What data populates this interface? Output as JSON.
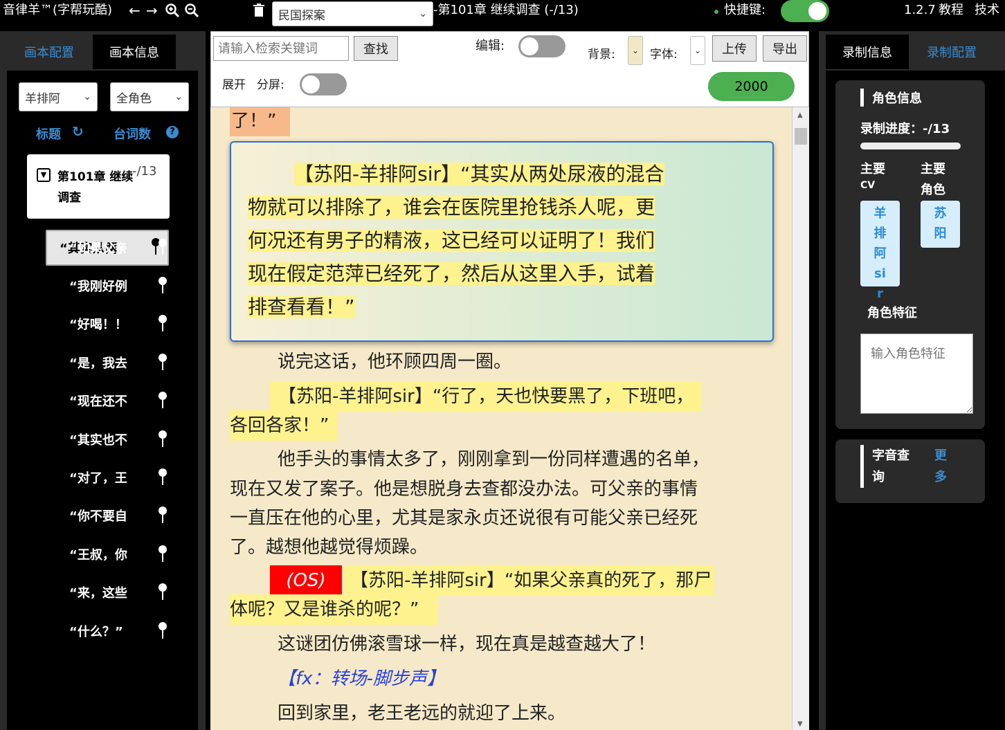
{
  "app": {
    "title": "音律羊™(字帮玩酷)",
    "book_select": "民国探案",
    "chapter_title": "-第101章 继续调查 (-/13)",
    "shortcut_label": "快捷键:",
    "version": "1.2.7",
    "tutorial": "教程",
    "tech": "技术"
  },
  "left": {
    "tabs": [
      "画本配置",
      "画本信息"
    ],
    "filter_cv": "羊排阿",
    "filter_role": "全角色",
    "title_label": "标题",
    "count_label": "台词数",
    "chapter": {
      "name": "第101章 继续调查",
      "count": "-/13"
    },
    "active_line": "“其实从两",
    "lines": [
      "“行了，天",
      "“如果父亲",
      "“我刚好例",
      "“好喝！！",
      "“是，我去",
      "“现在还不",
      "“其实也不",
      "“对了，王",
      "“你不要自",
      "“王叔，你",
      "“来，这些",
      "“什么？”"
    ]
  },
  "toolbar": {
    "search_placeholder": "请输入检索关键词",
    "search_button": "查找",
    "edit_label": "编辑:",
    "bg_label": "背景:",
    "font_label": "字体:",
    "upload": "上传",
    "export": "导出",
    "expand_label": "展开",
    "split_label": "分屏:",
    "counter": "2000"
  },
  "text": {
    "prev_tail": "了！”",
    "active_para": {
      "l1": "【苏阳-羊排阿sir】“其实从两处尿液的混合",
      "l2": "物就可以排除了，谁会在医院里抢钱杀人呢，更",
      "l3": "何况还有男子的精液，这已经可以证明了！我们",
      "l4": "现在假定范萍已经死了，然后从这里入手，试着",
      "l5": "排查看看！”"
    },
    "p1": "说完这话，他环顾四周一圈。",
    "p2_l1": "【苏阳-羊排阿sir】“行了，天也快要黑了，下班吧，",
    "p2_l2": "各回各家！”",
    "p3_l1": "他手头的事情太多了，刚刚拿到一份同样遭遇的名单，",
    "p3_l2": "现在又发了案子。他是想脱身去查都没办法。可父亲的事情",
    "p3_l3": "一直压在他的心里，尤其是家永贞还说很有可能父亲已经死",
    "p3_l4": "了。越想他越觉得烦躁。",
    "os_tag": "(OS)",
    "p4_l1": "【苏阳-羊排阿sir】“如果父亲真的死了，那尸",
    "p4_l2": "体呢？又是谁杀的呢？”",
    "p5": "这谜团仿佛滚雪球一样，现在真是越查越大了！",
    "fx": "【fx：转场-脚步声】",
    "p6": "回到家里，老王老远的就迎了上来。"
  },
  "right": {
    "tabs": [
      "录制信息",
      "录制配置"
    ],
    "role_info": "角色信息",
    "progress": "录制进度：-/13",
    "main_cv_label_1": "主要",
    "main_cv_label_2": "CV",
    "main_role_label_1": "主要",
    "main_role_label_2": "角色",
    "cv_chip": "羊排阿sir",
    "role_chip": "苏阳",
    "trait_label": "角色特征",
    "trait_placeholder": "输入角色特征",
    "lookup_label": "字音查询",
    "more": "更多"
  },
  "colors": {
    "accent_green": "#4caf50",
    "accent_blue": "#3a8bd1",
    "highlight_yellow": "#fdf28e",
    "paper": "#f5e9c9",
    "os_red": "#ff0000"
  }
}
